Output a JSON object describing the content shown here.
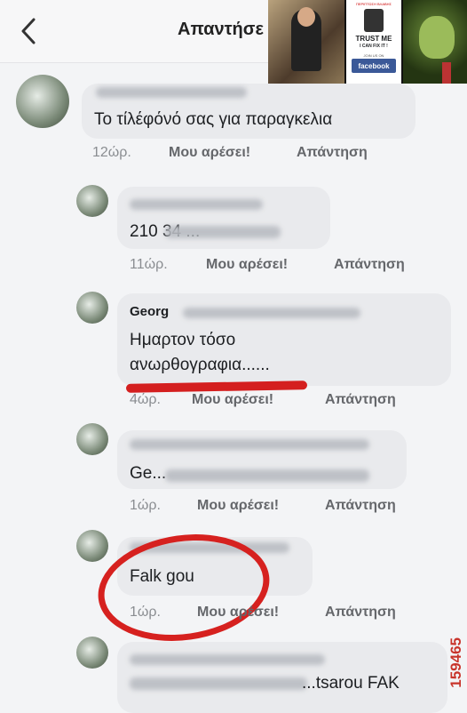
{
  "header": {
    "title": "Απαντήσε",
    "back_icon": "chevron-left-icon"
  },
  "meme": {
    "top_text": "ΠΕΡΙΠΤΩΣΗ ΒΛΑΒΗΣ",
    "trust": "TRUST ME",
    "fix": "I CAN FIX IT !",
    "join": "JOIN US ON",
    "facebook": "facebook"
  },
  "comments": [
    {
      "text": "Το τίλέφόνό σας για παραγκελια",
      "time": "12ώρ.",
      "like": "Μου αρέσει!",
      "reply": "Απάντηση"
    },
    {
      "text": "210 34 ...",
      "time": "11ώρ.",
      "like": "Μου αρέσει!",
      "reply": "Απάντηση"
    },
    {
      "name": "Georg",
      "text_line1": "Ημαρτον τόσο",
      "text_line2": "ανωρθογραφια......",
      "time": "4ώρ.",
      "like": "Μου αρέσει!",
      "reply": "Απάντηση"
    },
    {
      "text": "Ge...",
      "time": "1ώρ.",
      "like": "Μου αρέσει!",
      "reply": "Απάντηση"
    },
    {
      "text": "Falk gou",
      "time": "1ώρ.",
      "like": "Μου αρέσει!",
      "reply": "Απάντηση"
    },
    {
      "text": "...tsarou FAK"
    }
  ],
  "watermark": "159465",
  "colors": {
    "annotation_red": "#d6211f",
    "bubble_bg": "#e9eaed",
    "meta_text": "#65676b"
  }
}
